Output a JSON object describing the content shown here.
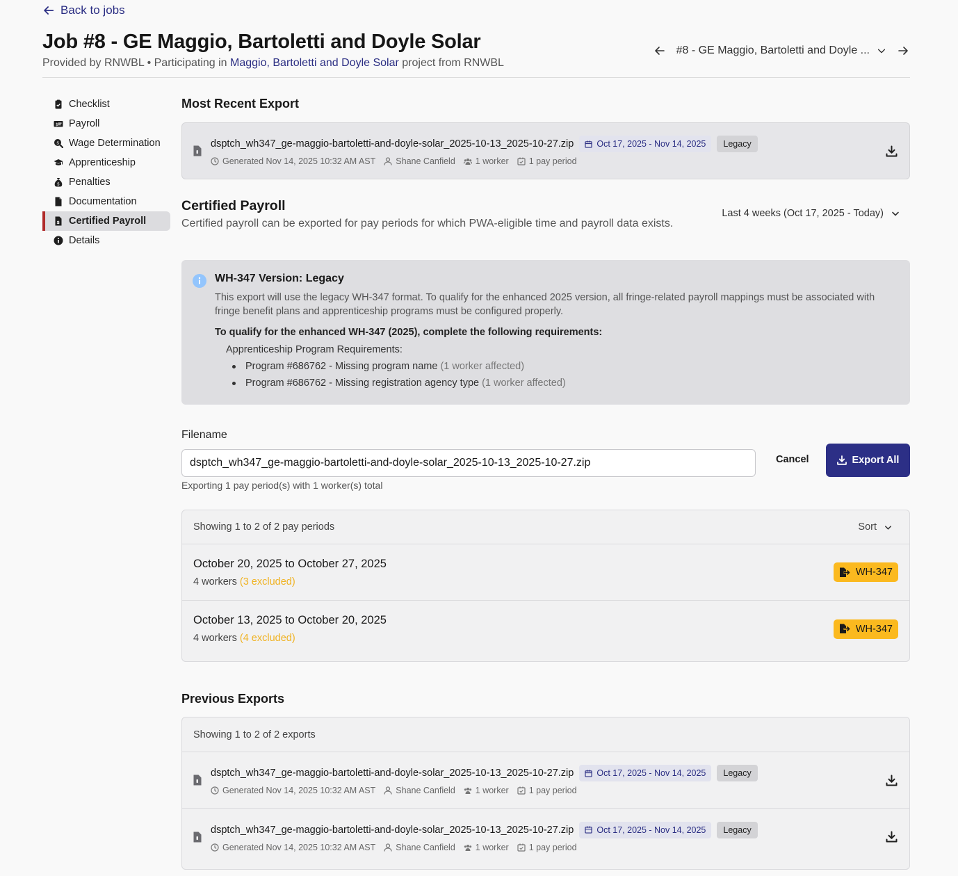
{
  "back_link": "Back to jobs",
  "header": {
    "title": "Job #8 - GE Maggio, Bartoletti and Doyle Solar",
    "subtitle_prefix": "Provided by RNWBL • Participating in ",
    "subtitle_link": "Maggio, Bartoletti and Doyle Solar",
    "subtitle_suffix": " project from RNWBL",
    "job_selector": "#8 - GE Maggio, Bartoletti and Doyle ..."
  },
  "sidebar": {
    "items": [
      {
        "label": "Checklist",
        "icon": "clipboard-check-icon"
      },
      {
        "label": "Payroll",
        "icon": "money-check-icon"
      },
      {
        "label": "Wage Determination",
        "icon": "search-dollar-icon"
      },
      {
        "label": "Apprenticeship",
        "icon": "graduation-cap-icon"
      },
      {
        "label": "Penalties",
        "icon": "money-bag-icon"
      },
      {
        "label": "Documentation",
        "icon": "file-icon"
      },
      {
        "label": "Certified Payroll",
        "icon": "file-invoice-icon",
        "active": true
      },
      {
        "label": "Details",
        "icon": "info-circle-icon"
      }
    ]
  },
  "most_recent": {
    "title": "Most Recent Export",
    "export": {
      "filename": "dsptch_wh347_ge-maggio-bartoletti-and-doyle-solar_2025-10-13_2025-10-27.zip",
      "date_range": "Oct 17, 2025 - Nov 14, 2025",
      "version": "Legacy",
      "generated": "Generated Nov 14, 2025 10:32 AM AST",
      "user": "Shane Canfield",
      "workers": "1 worker",
      "periods": "1 pay period"
    }
  },
  "certified_payroll": {
    "title": "Certified Payroll",
    "description": "Certified payroll can be exported for pay periods for which PWA-eligible time and payroll data exists.",
    "range": "Last 4 weeks (Oct 17, 2025 - Today)"
  },
  "info": {
    "title": "WH-347 Version: Legacy",
    "body": "This export will use the legacy WH-347 format. To qualify for the enhanced 2025 version, all fringe-related payroll mappings must be associated with fringe benefit plans and apprenticeship programs must be configured properly.",
    "qualify": "To qualify for the enhanced WH-347 (2025), complete the following requirements:",
    "req_heading": "Apprenticeship Program Requirements:",
    "requirements": [
      {
        "text": "Program #686762 - Missing program name",
        "affected": "(1 worker affected)"
      },
      {
        "text": "Program #686762 - Missing registration agency type",
        "affected": "(1 worker affected)"
      }
    ]
  },
  "filename_form": {
    "label": "Filename",
    "value": "dsptch_wh347_ge-maggio-bartoletti-and-doyle-solar_2025-10-13_2025-10-27.zip",
    "help": "Exporting 1 pay period(s) with 1 worker(s) total",
    "cancel": "Cancel",
    "export_all": "Export All"
  },
  "pay_periods": {
    "showing": "Showing 1 to 2 of 2 pay periods",
    "sort": "Sort",
    "rows": [
      {
        "title": "October 20, 2025 to October 27, 2025",
        "workers": "4 workers",
        "excluded": "(3 excluded)",
        "button": "WH-347"
      },
      {
        "title": "October 13, 2025 to October 20, 2025",
        "workers": "4 workers",
        "excluded": "(4 excluded)",
        "button": "WH-347"
      }
    ]
  },
  "previous": {
    "title": "Previous Exports",
    "showing": "Showing 1 to 2 of 2 exports",
    "rows": [
      {
        "filename": "dsptch_wh347_ge-maggio-bartoletti-and-doyle-solar_2025-10-13_2025-10-27.zip",
        "date_range": "Oct 17, 2025 - Nov 14, 2025",
        "version": "Legacy",
        "generated": "Generated Nov 14, 2025 10:32 AM AST",
        "user": "Shane Canfield",
        "workers": "1 worker",
        "periods": "1 pay period"
      },
      {
        "filename": "dsptch_wh347_ge-maggio-bartoletti-and-doyle-solar_2025-10-13_2025-10-27.zip",
        "date_range": "Oct 17, 2025 - Nov 14, 2025",
        "version": "Legacy",
        "generated": "Generated Nov 14, 2025 10:32 AM AST",
        "user": "Shane Canfield",
        "workers": "1 worker",
        "periods": "1 pay period"
      }
    ]
  },
  "colors": {
    "accent": "#2c2f86",
    "active_marker": "#b02a2a",
    "warning": "#fbb91f"
  }
}
